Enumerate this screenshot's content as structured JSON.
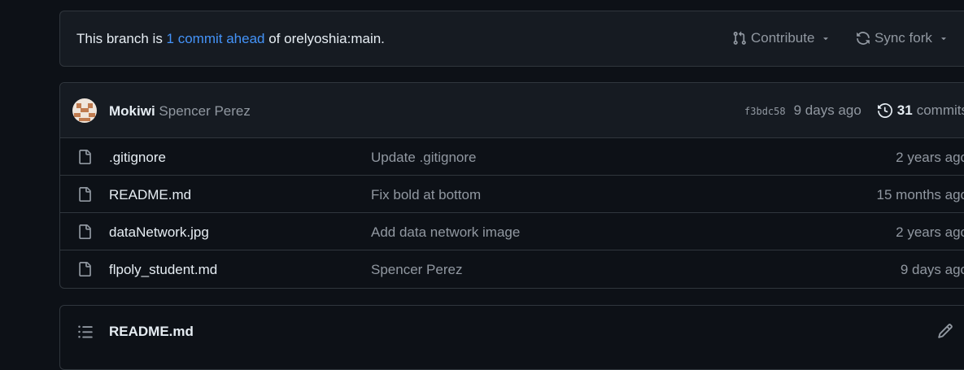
{
  "branch_banner": {
    "text_before": "This branch is ",
    "link_text": "1 commit ahead",
    "text_after": " of orelyoshia:main.",
    "contribute_label": "Contribute",
    "sync_fork_label": "Sync fork",
    "icons": [
      "git-pull-request-icon",
      "sync-icon",
      "caret-down-icon"
    ]
  },
  "latest_commit": {
    "author": "Mokiwi",
    "message": "Spencer Perez",
    "sha": "f3bdc58",
    "age": "9 days ago",
    "commit_count": "31",
    "commit_count_label": "commits",
    "icons": [
      "avatar",
      "history-icon"
    ]
  },
  "files": [
    {
      "name": ".gitignore",
      "message": "Update .gitignore",
      "age": "2 years ago"
    },
    {
      "name": "README.md",
      "message": "Fix bold at bottom",
      "age": "15 months ago"
    },
    {
      "name": "dataNetwork.jpg",
      "message": "Add data network image",
      "age": "2 years ago"
    },
    {
      "name": "flpoly_student.md",
      "message": "Spencer Perez",
      "age": "9 days ago"
    }
  ],
  "readme": {
    "title": "README.md",
    "icons": [
      "list-unordered-icon",
      "pencil-icon"
    ]
  },
  "colors": {
    "background": "#0d1117",
    "surface": "#161b22",
    "border": "#30363d",
    "text": "#e6edf3",
    "muted": "#9198a1",
    "link": "#4493f8"
  }
}
